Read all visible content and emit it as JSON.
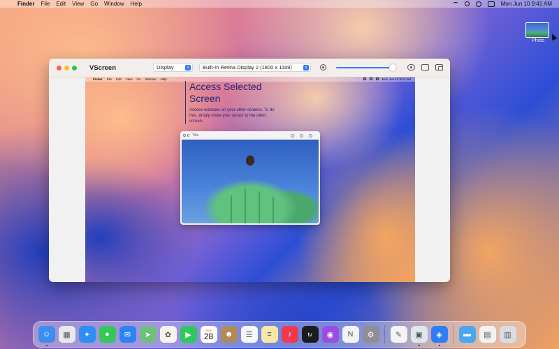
{
  "menubar": {
    "apple_icon": "apple-logo-icon",
    "items": [
      "Finder",
      "File",
      "Edit",
      "View",
      "Go",
      "Window",
      "Help"
    ],
    "datetime": "Mon Jun 10  9:41 AM"
  },
  "desktop": {
    "photo_label": "Photo"
  },
  "window": {
    "title": "VScreen",
    "display_select": "Display",
    "monitor_select": "Built-In Retina Display 2 (1800 x 1169)",
    "slider_value": 0.95
  },
  "preview": {
    "menubar": {
      "items": [
        "Finder",
        "File",
        "Edit",
        "View",
        "Go",
        "Window",
        "Help"
      ],
      "datetime": "Mon Jun 10  9:41 AM"
    },
    "banner": {
      "title": "Access Selected Screen",
      "text": "Access windows on your other screens. To do this, simply move your cursor to the other screen."
    },
    "inner_window": {
      "title": "Title"
    }
  },
  "dock": {
    "apps": [
      {
        "name": "finder-icon",
        "color": "#3b8df0",
        "glyph": "☺"
      },
      {
        "name": "launchpad-icon",
        "color": "#e8e8ee",
        "glyph": "▦"
      },
      {
        "name": "safari-icon",
        "color": "#2f8ef5",
        "glyph": "✦"
      },
      {
        "name": "messages-icon",
        "color": "#35c759",
        "glyph": "●"
      },
      {
        "name": "mail-icon",
        "color": "#2c84f2",
        "glyph": "✉"
      },
      {
        "name": "maps-icon",
        "color": "#6fc07a",
        "glyph": "➤"
      },
      {
        "name": "photos-icon",
        "color": "#f6f2ee",
        "glyph": "✿"
      },
      {
        "name": "facetime-icon",
        "color": "#30c85a",
        "glyph": "▶"
      },
      {
        "name": "calendar-icon",
        "color": "#ffffff",
        "month": "FEB",
        "day": "28"
      },
      {
        "name": "contacts-icon",
        "color": "#b08a5a",
        "glyph": "☻"
      },
      {
        "name": "reminders-icon",
        "color": "#f7f7f7",
        "glyph": "☰"
      },
      {
        "name": "notes-icon",
        "color": "#f7e8a8",
        "glyph": "≡"
      },
      {
        "name": "music-icon",
        "color": "#f3394f",
        "glyph": "♪"
      },
      {
        "name": "tv-icon",
        "color": "#1c1c1e",
        "glyph": "tv"
      },
      {
        "name": "podcasts-icon",
        "color": "#9b4de0",
        "glyph": "◉"
      },
      {
        "name": "news-icon",
        "color": "#f3f3f3",
        "glyph": "N"
      },
      {
        "name": "system-settings-icon",
        "color": "#8e8e93",
        "glyph": "⚙"
      },
      {
        "name": "textedit-icon",
        "color": "#f4f4f4",
        "glyph": "✎"
      },
      {
        "name": "preview-icon",
        "color": "#dfe6ef",
        "glyph": "▣"
      },
      {
        "name": "vscreen-icon",
        "color": "#2e7cf6",
        "glyph": "◈"
      },
      {
        "name": "folder-icon",
        "color": "#4aa6ef",
        "glyph": "▬"
      },
      {
        "name": "documents-stack-icon",
        "color": "#f2f2f2",
        "glyph": "▤"
      },
      {
        "name": "trash-icon",
        "color": "#d9dde2",
        "glyph": "▥"
      }
    ]
  }
}
